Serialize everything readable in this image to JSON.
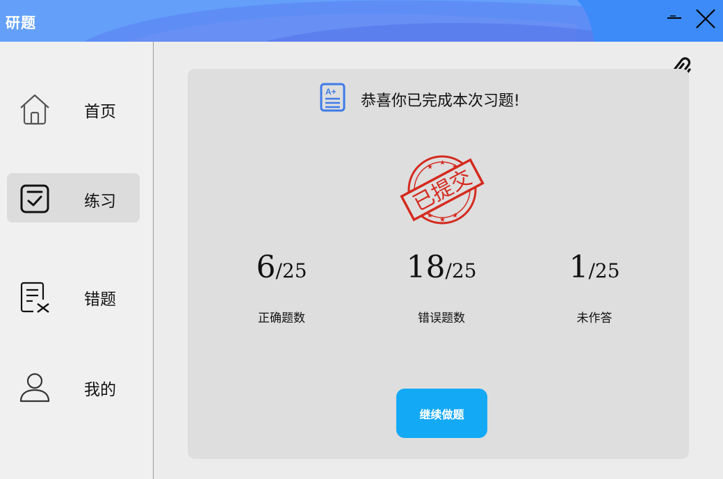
{
  "app": {
    "title": "研题"
  },
  "colors": {
    "titlebar": "#64a0fa",
    "accent": "#14a9f5",
    "stamp": "#d42a1e",
    "doc_icon": "#3d7be8"
  },
  "sidebar": {
    "items": [
      {
        "label": "首页",
        "icon": "home-icon",
        "active": false
      },
      {
        "label": "练习",
        "icon": "checkbox-icon",
        "active": true
      },
      {
        "label": "错题",
        "icon": "wrong-list-icon",
        "active": false
      },
      {
        "label": "我的",
        "icon": "user-icon",
        "active": false
      }
    ]
  },
  "result": {
    "header_text": "恭喜你已完成本次习题!",
    "stamp_text": "已提交",
    "stats": [
      {
        "value": "6",
        "total": "/25",
        "label": "正确题数"
      },
      {
        "value": "18",
        "total": "/25",
        "label": "错误题数"
      },
      {
        "value": "1",
        "total": "/25",
        "label": "未作答"
      }
    ],
    "continue_button": "继续做题"
  }
}
